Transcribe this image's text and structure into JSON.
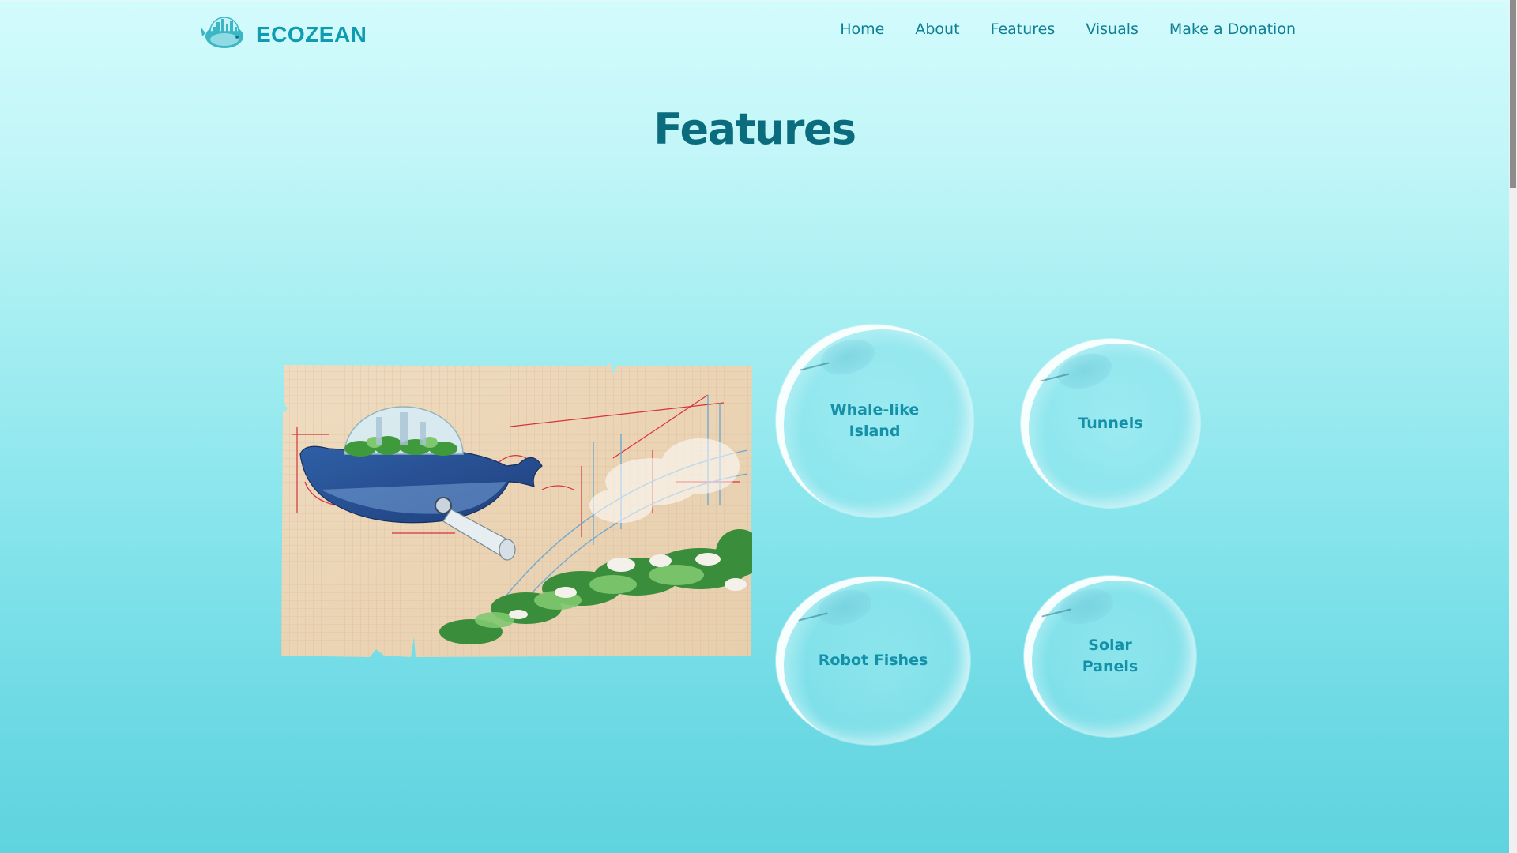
{
  "brand": {
    "name": "ECOZEAN",
    "logo_icon": "whale-city-logo"
  },
  "nav": {
    "items": [
      {
        "label": "Home"
      },
      {
        "label": "About"
      },
      {
        "label": "Features"
      },
      {
        "label": "Visuals"
      },
      {
        "label": "Make a Donation"
      }
    ]
  },
  "main": {
    "title": "Features",
    "image_alt_icon": "whale-island-sketch",
    "features": [
      {
        "label": "Whale-like\nIsland"
      },
      {
        "label": "Tunnels"
      },
      {
        "label": "Robot Fishes"
      },
      {
        "label": "Solar\nPanels"
      }
    ]
  },
  "colors": {
    "accent": "#0f9bb1",
    "title": "#0b6c7d",
    "nav": "#0f7f94",
    "bubble_text": "#1490a8"
  }
}
